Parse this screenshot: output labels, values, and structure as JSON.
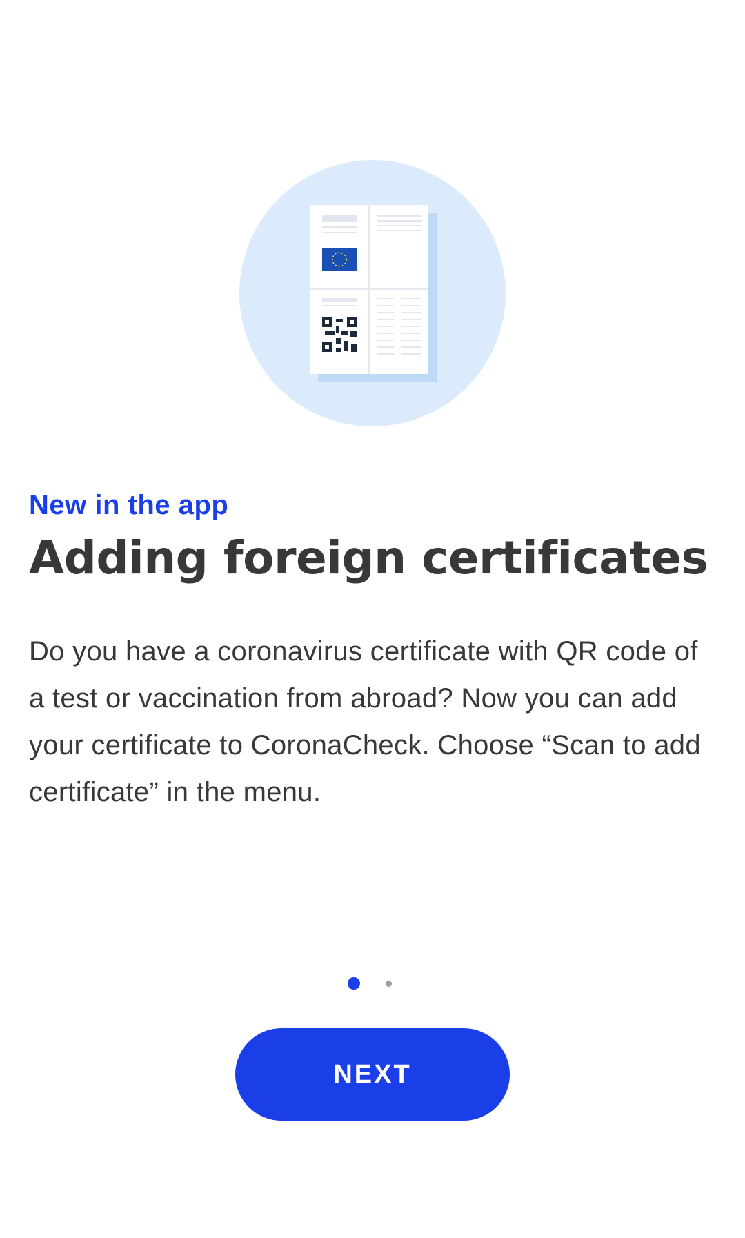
{
  "onboarding": {
    "eyebrow": "New in the app",
    "title": "Adding foreign certificates",
    "body": "Do you have a coronavirus certificate with QR code of a test or vaccination from abroad? Now you can add your certificate to CoronaCheck. Choose “Scan to add certificate” in the menu.",
    "illustration_icon": "certificate-document-icon"
  },
  "pager": {
    "page": 1,
    "total_pages": 2
  },
  "actions": {
    "next_label": "NEXT"
  },
  "colors": {
    "accent": "#1a3ee8",
    "title_text": "#383838",
    "body_text": "#383838",
    "illustration_bg": "#dcebfb",
    "inactive_dot": "#a0a0a0"
  }
}
